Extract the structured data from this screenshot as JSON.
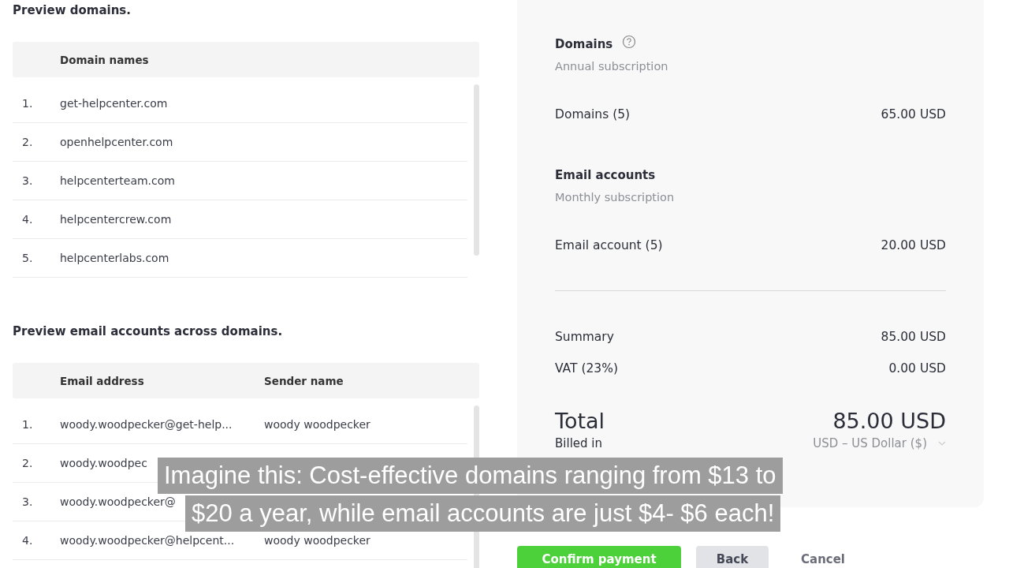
{
  "domains_section": {
    "title": "Preview domains.",
    "columns": [
      "Domain names"
    ],
    "rows": [
      {
        "index": "1.",
        "domain": "get-helpcenter.com"
      },
      {
        "index": "2.",
        "domain": "openhelpcenter.com"
      },
      {
        "index": "3.",
        "domain": "helpcenterteam.com"
      },
      {
        "index": "4.",
        "domain": "helpcentercrew.com"
      },
      {
        "index": "5.",
        "domain": "helpcenterlabs.com"
      }
    ]
  },
  "email_section": {
    "title": "Preview email accounts across domains.",
    "columns": [
      "Email address",
      "Sender name"
    ],
    "rows": [
      {
        "index": "1.",
        "email": "woody.woodpecker@get-help...",
        "sender": "woody woodpecker"
      },
      {
        "index": "2.",
        "email": "woody.woodpec"
      },
      {
        "index": "3.",
        "email": "woody.woodpecker@"
      },
      {
        "index": "4.",
        "email": "woody.woodpecker@helpcent...",
        "sender": "woody woodpecker"
      }
    ]
  },
  "order_summary": {
    "groups": [
      {
        "title": "Domains",
        "help_icon": true,
        "subtitle": "Annual subscription",
        "item": "Domains (5)",
        "price": "65.00 USD"
      },
      {
        "title": "Email accounts",
        "help_icon": false,
        "subtitle": "Monthly subscription",
        "item": "Email account (5)",
        "price": "20.00 USD"
      }
    ],
    "summary": [
      {
        "label": "Summary",
        "value": "85.00 USD"
      },
      {
        "label": "VAT (23%)",
        "value": "0.00 USD"
      }
    ],
    "total_label": "Total",
    "total_value": "85.00 USD",
    "billed_in_label": "Billed in",
    "currency": "USD – US Dollar ($)"
  },
  "buttons": [
    {
      "kind": "primary",
      "label": "Confirm payment"
    },
    {
      "kind": "secondary",
      "label": "Back"
    },
    {
      "kind": "link",
      "label": "Cancel"
    }
  ],
  "caption": [
    "Imagine this: Cost-effective domains ranging from $13 to",
    "$20 a year, while email accounts are just $4- $6 each!"
  ]
}
